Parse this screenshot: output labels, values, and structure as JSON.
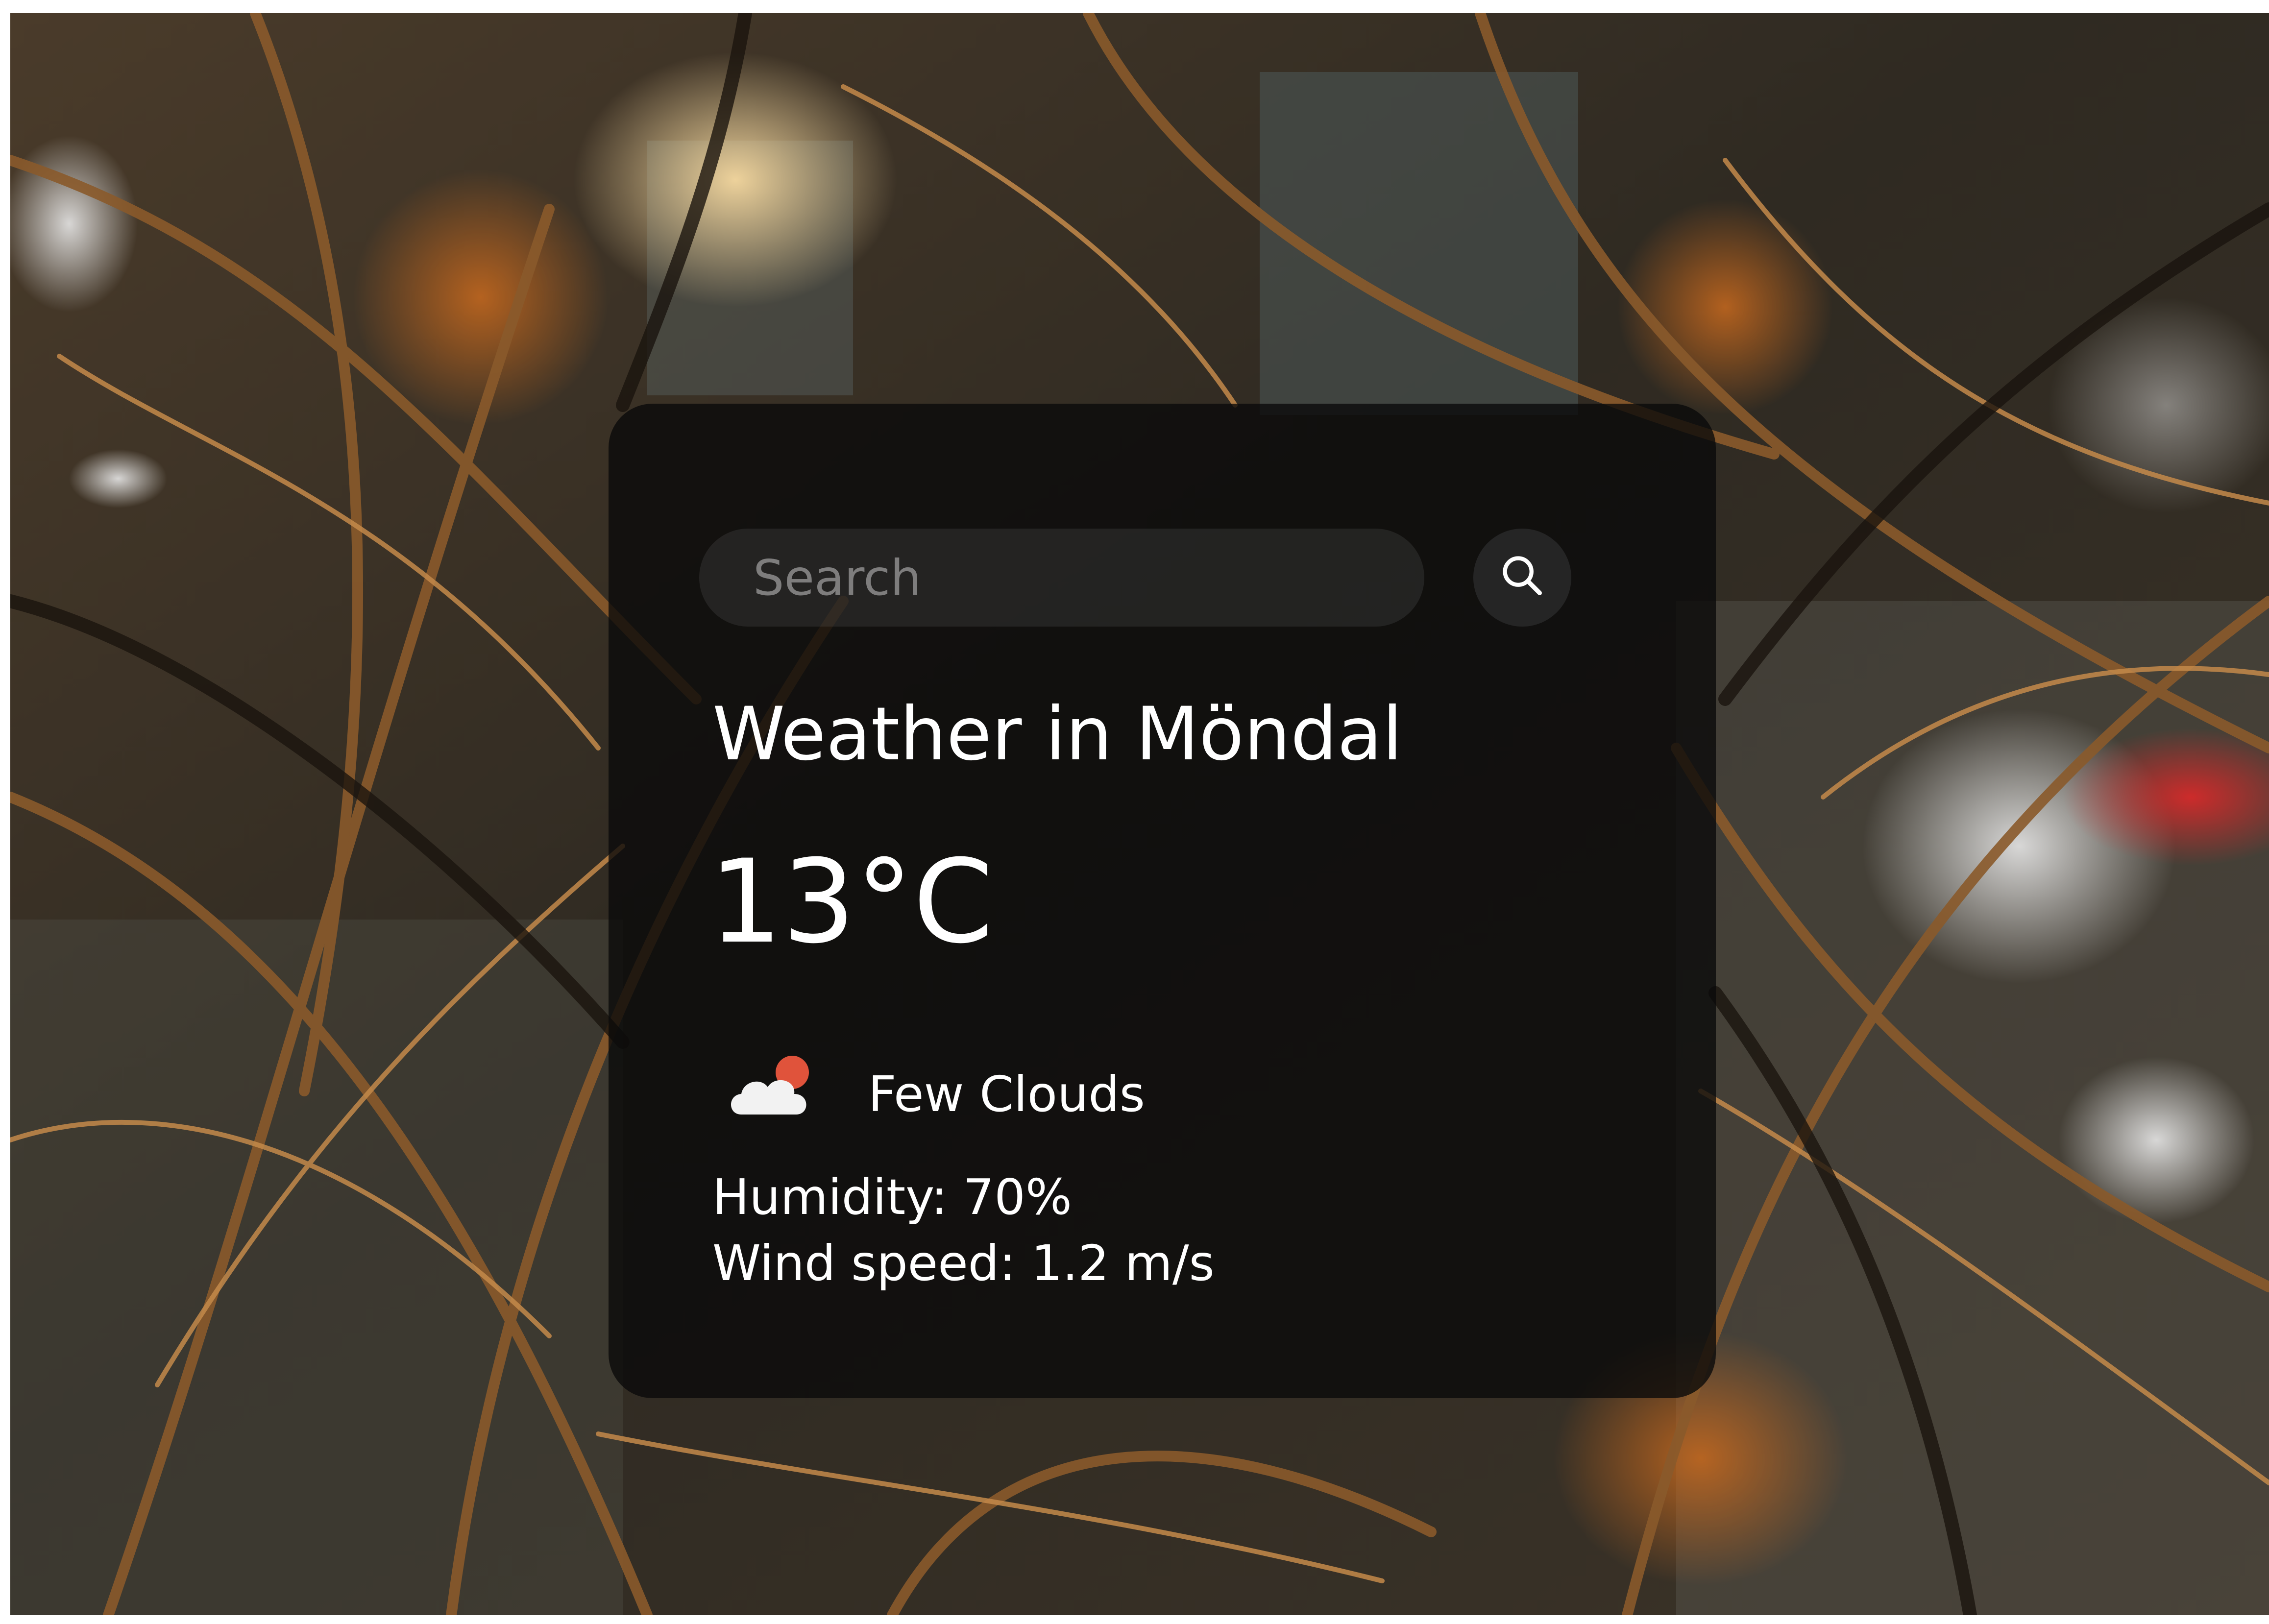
{
  "search": {
    "placeholder": "Search",
    "value": ""
  },
  "weather": {
    "title": "Weather in Möndal",
    "temperature": "13°C",
    "condition": "Few Clouds",
    "condition_icon": "few-clouds-icon",
    "humidity": "Humidity: 70%",
    "wind": "Wind speed: 1.2 m/s"
  },
  "background": {
    "description_icon": "background-photo"
  },
  "colors": {
    "card": "#0a0a0a",
    "text": "#ffffff",
    "sun_accent": "#e0533b"
  }
}
